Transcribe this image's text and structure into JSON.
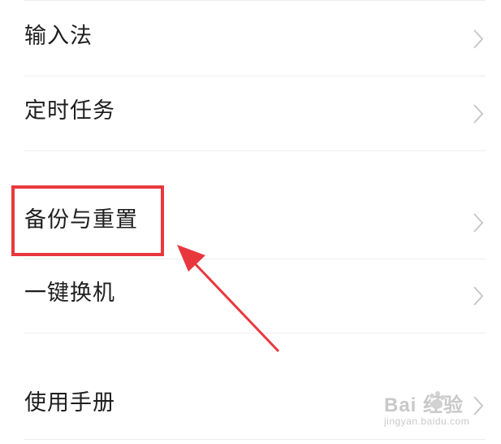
{
  "settings_list": {
    "items": [
      {
        "label": "输入法"
      },
      {
        "label": "定时任务"
      },
      {
        "label": "备份与重置"
      },
      {
        "label": "一键换机"
      },
      {
        "label": "使用手册"
      }
    ]
  },
  "annotation": {
    "highlight_color": "#e8383d",
    "arrow_color": "#e8383d"
  },
  "watermark": {
    "logo_text": "Bai 经验",
    "sub_text": "jingyan.baidu.com"
  },
  "colors": {
    "text": "#1e1e1e",
    "chevron": "#c8c8c8",
    "divider": "#ededed"
  }
}
